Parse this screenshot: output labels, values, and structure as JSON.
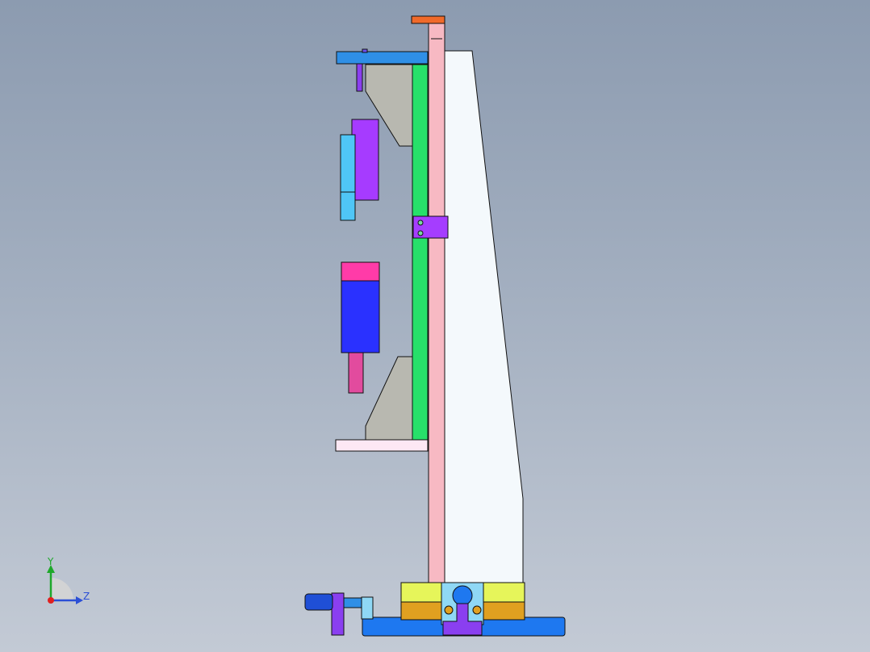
{
  "view": {
    "type": "cad-viewport",
    "background_top": "#8c9bb0",
    "background_bottom": "#c3cad5"
  },
  "triad": {
    "y_label": "Y",
    "z_label": "Z",
    "y_color": "#1ea82a",
    "z_color": "#2b4fd6",
    "x_color": "#e02020"
  },
  "parts": [
    {
      "name": "top-cap",
      "color": "#f06a2a"
    },
    {
      "name": "vertical-column",
      "color": "#f7b9c3"
    },
    {
      "name": "back-gusset-plate",
      "color": "#f4f9fc"
    },
    {
      "name": "top-arm",
      "color": "#2f8fe6"
    },
    {
      "name": "green-rail",
      "color": "#27e06a"
    },
    {
      "name": "upper-bracket",
      "color": "#b8b8b0"
    },
    {
      "name": "purple-block",
      "color": "#a63bff"
    },
    {
      "name": "cyan-block",
      "color": "#4fc6f6"
    },
    {
      "name": "column-clamp",
      "color": "#a53dff"
    },
    {
      "name": "magenta-cap",
      "color": "#ff3ba8"
    },
    {
      "name": "blue-motor",
      "color": "#2a31ff"
    },
    {
      "name": "pink-rod",
      "color": "#e24b9e"
    },
    {
      "name": "lower-bracket",
      "color": "#b8b8b0"
    },
    {
      "name": "bottom-arm",
      "color": "#fde8f4"
    },
    {
      "name": "yellow-clamp-block",
      "color": "#e6f55a"
    },
    {
      "name": "orange-base-block",
      "color": "#e0a020"
    },
    {
      "name": "base-plate",
      "color": "#1e78f0"
    },
    {
      "name": "handle-knob",
      "color": "#1f4fd6"
    },
    {
      "name": "handle-lever",
      "color": "#8a3ff0"
    }
  ]
}
